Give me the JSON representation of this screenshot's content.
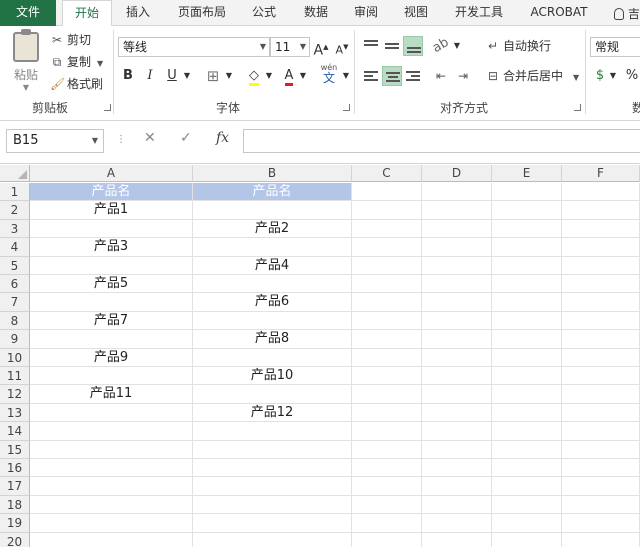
{
  "tabs": [
    "文件",
    "开始",
    "插入",
    "页面布局",
    "公式",
    "数据",
    "审阅",
    "视图",
    "开发工具",
    "ACROBAT"
  ],
  "tell_me": "吉",
  "clipboard": {
    "paste": "粘贴",
    "cut": "剪切",
    "copy": "复制",
    "format_painter": "格式刷",
    "group_label": "剪贴板"
  },
  "font": {
    "name": "等线",
    "size": "11",
    "grow": "A",
    "shrink": "A",
    "bold": "B",
    "italic": "I",
    "underline": "U",
    "font_color_glyph": "A",
    "phonetic": "wén",
    "phonetic_char": "文",
    "group_label": "字体"
  },
  "alignment": {
    "wrap_text": "自动换行",
    "merge_center": "合并后居中",
    "group_label": "对齐方式"
  },
  "number": {
    "format": "常规",
    "percent": "%",
    "group_label_partial": "数"
  },
  "formula_bar": {
    "name_box": "B15",
    "cancel": "✕",
    "enter": "✓",
    "fx": "fx",
    "value": ""
  },
  "grid": {
    "columns": [
      "A",
      "B",
      "C",
      "D",
      "E",
      "F"
    ],
    "rows": [
      "1",
      "2",
      "3",
      "4",
      "5",
      "6",
      "7",
      "8",
      "9",
      "10",
      "11",
      "12",
      "13",
      "14",
      "15",
      "16",
      "17",
      "18",
      "19",
      "20"
    ],
    "cells": {
      "A1": "产品名",
      "B1": "产品名",
      "A2": "产品1",
      "B3": "产品2",
      "A4": "产品3",
      "B5": "产品4",
      "A6": "产品5",
      "B7": "产品6",
      "A8": "产品7",
      "B9": "产品8",
      "A10": "产品9",
      "B11": "产品10",
      "A12": "产品11",
      "B13": "产品12"
    },
    "header_fill": "#B4C6E7",
    "header_text_color": "#FFFFFF"
  },
  "colors": {
    "excel_green": "#217346",
    "selected_align": "#B9DCC4",
    "font_color_bar": "#E02020",
    "highlight_bar": "#FFFF00"
  }
}
